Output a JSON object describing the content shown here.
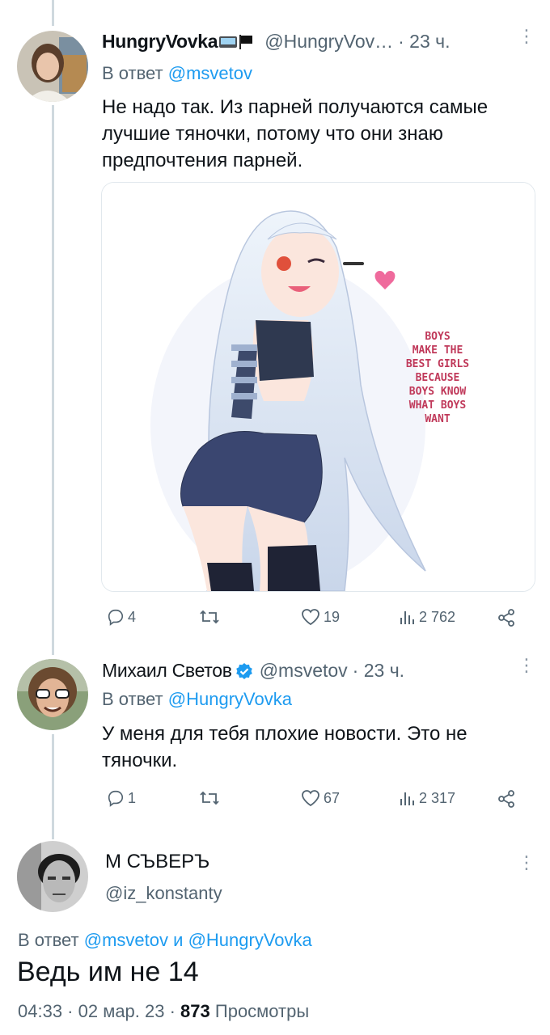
{
  "tweet1": {
    "name": "HungryVovka",
    "name_emoji": "💻🏴",
    "handle": "@HungryVov…",
    "time": "· 23 ч.",
    "reply_prefix": "В ответ",
    "reply_to": "@msvetov",
    "text": "Не надо так. Из парней получаются самые лучшие тяночки, потому что они знаю предпочтения парней.",
    "image_text": [
      "BOYS",
      "MAKE THE",
      "BEST GIRLS",
      "BECAUSE",
      "BOYS KNOW",
      "WHAT BOYS",
      "WANT"
    ],
    "replies": "4",
    "retweets": "",
    "likes": "19",
    "views": "2 762"
  },
  "tweet2": {
    "name": "Михаил Светов",
    "handle": "@msvetov",
    "time": "· 23 ч.",
    "reply_prefix": "В ответ",
    "reply_to": "@HungryVovka",
    "text": "У меня для тебя плохие новости. Это не тяночки.",
    "replies": "1",
    "retweets": "",
    "likes": "67",
    "views": "2 317"
  },
  "tweet3": {
    "name": "М СЪВЕРЪ",
    "handle": "@iz_konstanty",
    "reply_prefix": "В ответ",
    "reply_to_1": "@msvetov",
    "reply_and": "и",
    "reply_to_2": "@HungryVovka",
    "text": "Ведь им не 14",
    "timestamp": "04:33 · 02 мар. 23 ·",
    "views_count": "873",
    "views_label": "Просмотры"
  },
  "icons": {
    "more": "more-vertical-icon",
    "reply": "reply-icon",
    "retweet": "retweet-icon",
    "like": "heart-icon",
    "views": "views-icon",
    "share": "share-icon",
    "verified": "verified-badge-icon"
  },
  "colors": {
    "link": "#1d9bf0",
    "secondary": "#536471",
    "thread_line": "#cfd9de",
    "verified": "#1d9bf0",
    "image_text": "#c0395a"
  }
}
